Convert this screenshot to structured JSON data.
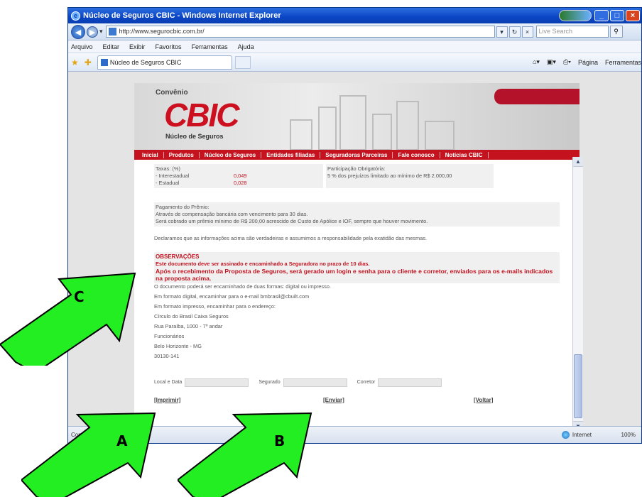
{
  "window": {
    "title": "Núcleo de Seguros CBIC - Windows Internet Explorer",
    "address": "http://www.segurocbic.com.br/",
    "search_placeholder": "Live Search",
    "menu": [
      "Arquivo",
      "Editar",
      "Exibir",
      "Favoritos",
      "Ferramentas",
      "Ajuda"
    ],
    "tab_title": "Núcleo de Seguros CBIC",
    "tools": [
      "Página",
      "Ferramentas"
    ],
    "status_left": "Concluído",
    "status_zone": "Internet",
    "status_zoom": "100%"
  },
  "site": {
    "convenio": "Convênio",
    "logo": "CBIC",
    "subtitle": "Núcleo de Seguros",
    "nav": [
      "Inicial",
      "Produtos",
      "Núcleo de Seguros",
      "Entidades filiadas",
      "Seguradoras Parceiras",
      "Fale conosco",
      "Notícias CBIC"
    ]
  },
  "form": {
    "taxas_title": "Taxas: (%)",
    "taxas": [
      {
        "label": "- Interestadual",
        "value": "0,049"
      },
      {
        "label": "- Estadual",
        "value": "0,028"
      }
    ],
    "participacao_title": "Participação Obrigatória:",
    "participacao_text": "5 % dos prejuízos limitado ao mínimo de R$ 2.000,00",
    "pagamento_title": "Pagamento do Prêmio:",
    "pagamento_lines": [
      "Através de compensação bancária com vencimento para 30 dias.",
      "Será cobrado um prêmio mínimo de R$ 200,00 acrescido de Custo de Apólice e IOF, sempre que houver movimento."
    ],
    "declaracao": "Declaramos que as informações acima são verdadeiras e assumimos a responsabilidade pela exatidão das mesmas.",
    "obs_title": "OBSERVAÇÕES",
    "obs_red": "Este documento deve ser assinado e encaminhado a Seguradora no prazo de 10 dias.",
    "obs_big": "Após o recebimento da Proposta de Seguros, será gerado um login e senha para o cliente e corretor, enviados para os e-mails indicados na proposta acima.",
    "obs_lines": [
      "O documento poderá ser encaminhado de duas formas: digital ou impresso.",
      "Em formato digital, encaminhar para o e-mail bmbrasil@cbuilt.com",
      "Em formato impresso, encaminhar para o endereço:",
      "Círculo do Brasil Caixa Seguros",
      "Rua Paraíba, 1000 - 7º andar",
      "Funcionários",
      "Belo Horizonte - MG",
      "30130-141"
    ],
    "sig_labels": [
      "Local e Data",
      "Segurado",
      "Corretor"
    ],
    "buttons": {
      "print": "[Imprimir]",
      "send": "[Enviar]",
      "back": "[Voltar]"
    }
  },
  "callouts": [
    "C",
    "A",
    "B"
  ],
  "colors": {
    "arrow_fill": "#22ee22",
    "cbic_red": "#c4121f"
  }
}
